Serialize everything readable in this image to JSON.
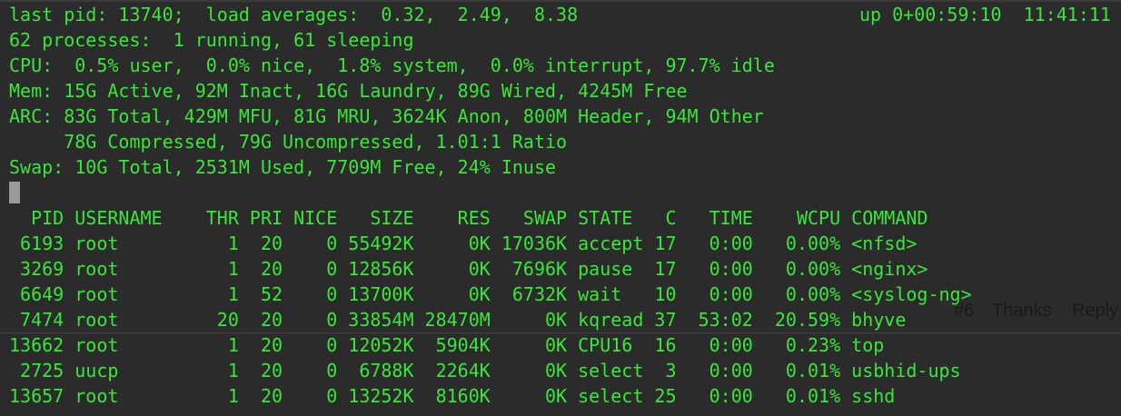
{
  "summary": {
    "line1_left": "last pid: 13740;  load averages:  0.32,  2.49,  8.38",
    "line1_right": "up 0+00:59:10  11:41:11",
    "line2": "62 processes:  1 running, 61 sleeping",
    "line3": "CPU:  0.5% user,  0.0% nice,  1.8% system,  0.0% interrupt, 97.7% idle",
    "line4": "Mem: 15G Active, 92M Inact, 16G Laundry, 89G Wired, 4245M Free",
    "line5": "ARC: 83G Total, 429M MFU, 81G MRU, 3624K Anon, 800M Header, 94M Other",
    "line6": "     78G Compressed, 79G Uncompressed, 1.01:1 Ratio",
    "line7": "Swap: 10G Total, 2531M Used, 7709M Free, 24% Inuse"
  },
  "table": {
    "header": "  PID USERNAME    THR PRI NICE   SIZE    RES   SWAP STATE   C   TIME    WCPU COMMAND",
    "rows": [
      " 6193 root          1  20    0 55492K     0K 17036K accept 17   0:00   0.00% <nfsd>",
      " 3269 root          1  20    0 12856K     0K  7696K pause  17   0:00   0.00% <nginx>",
      " 6649 root          1  52    0 13700K     0K  6732K wait   10   0:00   0.00% <syslog-ng>",
      " 7474 root         20  20    0 33854M 28470M     0K kqread 37  53:02  20.59% bhyve",
      "13662 root          1  20    0 12052K  5904K     0K CPU16  16   0:00   0.23% top",
      " 2725 uucp          1  20    0  6788K  2264K     0K select  3   0:00   0.01% usbhid-ups",
      "13657 root          1  20    0 13252K  8160K     0K select 25   0:00   0.01% sshd"
    ]
  },
  "overlay": {
    "post_number": "#6",
    "thanks_label": "Thanks",
    "reply_label": "Reply"
  },
  "colors": {
    "terminal_bg": "#2b2b2b",
    "terminal_text": "#39e639",
    "overlay_text": "#1a1a1a"
  }
}
